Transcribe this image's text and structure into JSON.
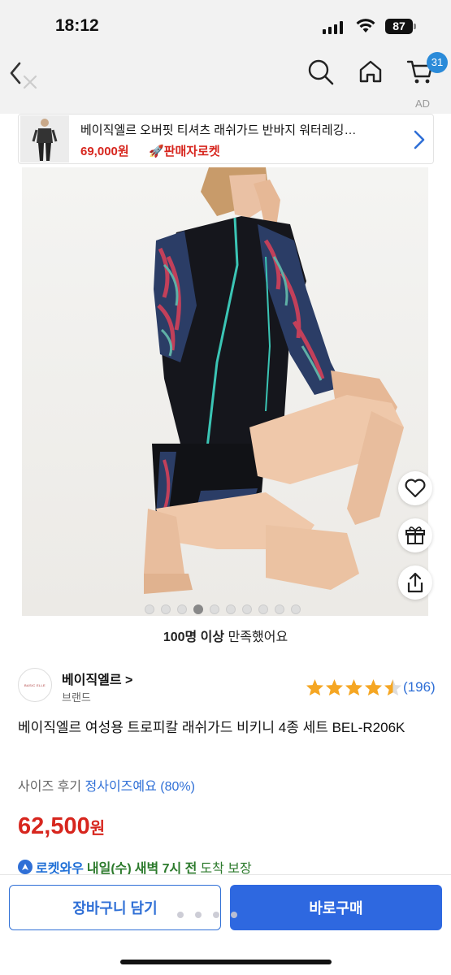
{
  "status_bar": {
    "time": "18:12",
    "battery": "87"
  },
  "nav": {
    "cart_count": "31",
    "ad_label": "AD"
  },
  "ad_banner": {
    "title": "베이직엘르 오버핏 티셔츠 래쉬가드 반바지 워터레깅…",
    "price": "69,000원",
    "badge": "판매자로켓"
  },
  "gallery": {
    "total_images": 10,
    "active_index": 3
  },
  "satisfaction": {
    "bold": "100명 이상",
    "rest": " 만족했어요"
  },
  "brand": {
    "logo_text": "BASIC ELLE",
    "name": "베이직엘르 >",
    "subtitle": "브랜드"
  },
  "rating": {
    "value": 4.5,
    "max": 5,
    "count": "(196)"
  },
  "product": {
    "title": "베이직엘르 여성용 트로피칼 래쉬가드 비키니 4종 세트 BEL-R206K"
  },
  "size_review": {
    "label": "사이즈 후기",
    "value": "정사이즈예요",
    "percent": "(80%)"
  },
  "price": {
    "amount": "62,500",
    "unit": "원"
  },
  "delivery": {
    "service": "로켓와우",
    "date": "내일(수)",
    "time": "새벽 7시 전",
    "note": "도착 보장"
  },
  "actions": {
    "add_to_cart": "장바구니 담기",
    "buy_now": "바로구매"
  },
  "colors": {
    "accent_blue": "#2e68e0",
    "price_red": "#d7261e",
    "link_blue": "#2f6fd6",
    "star": "#f5a623"
  }
}
